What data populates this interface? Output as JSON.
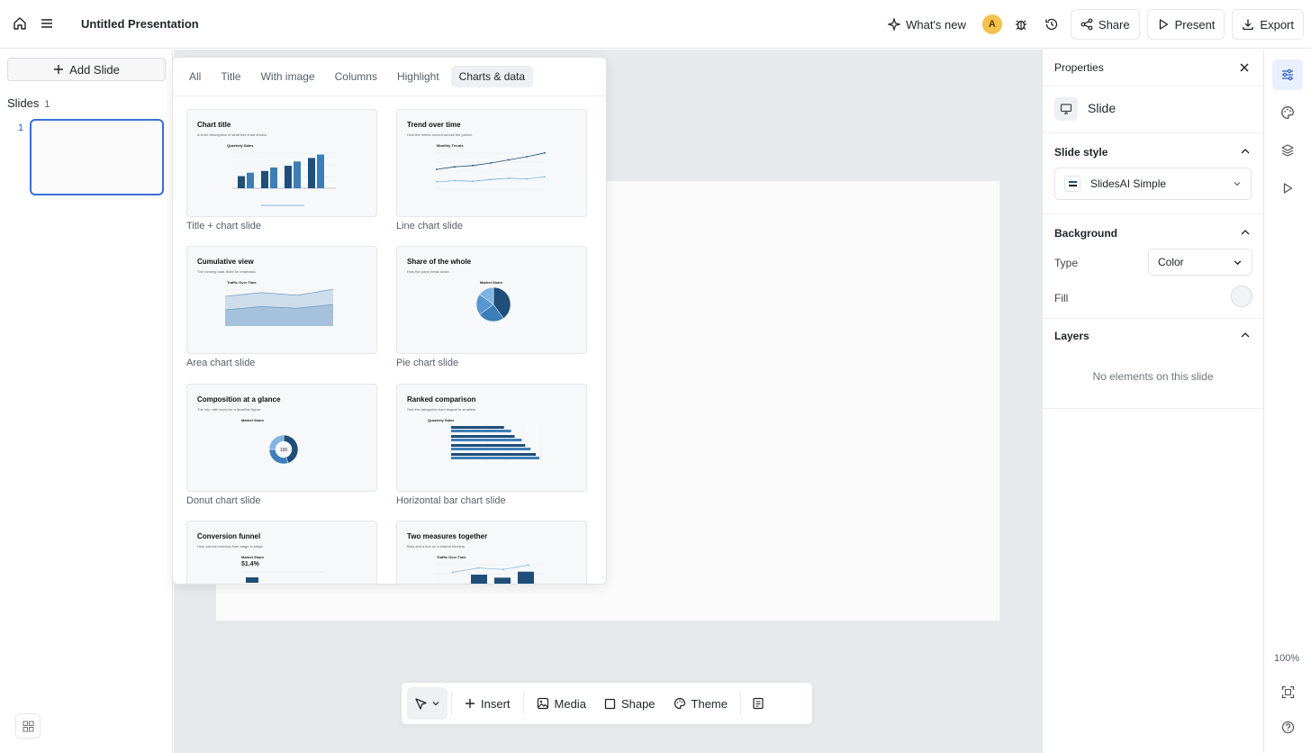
{
  "app": {
    "title": "Untitled Presentation"
  },
  "toolbar": {
    "whats_new": "What's new",
    "avatar_initial": "A",
    "share": "Share",
    "present": "Present",
    "export": "Export"
  },
  "sidebar": {
    "add_slide": "Add Slide",
    "slides_label": "Slides",
    "slides_count": "1",
    "slide_numbers": [
      "1"
    ]
  },
  "template_picker": {
    "tabs": [
      "All",
      "Title",
      "With image",
      "Columns",
      "Highlight",
      "Charts & data"
    ],
    "active_tab": "Charts & data",
    "templates": [
      {
        "preview_title": "Chart title",
        "preview_subtitle": "A short description of what this chart shows.",
        "label": "Title + chart slide"
      },
      {
        "preview_title": "Trend over time",
        "preview_subtitle": "How the metric moved across the period.",
        "label": "Line chart slide"
      },
      {
        "preview_title": "Cumulative view",
        "preview_subtitle": "The running total, filled for emphasis.",
        "label": "Area chart slide"
      },
      {
        "preview_title": "Share of the whole",
        "preview_subtitle": "How the parts break down.",
        "label": "Pie chart slide"
      },
      {
        "preview_title": "Composition at a glance",
        "preview_subtitle": "The mix, with room for a headline figure.",
        "label": "Donut chart slide"
      },
      {
        "preview_title": "Ranked comparison",
        "preview_subtitle": "Sort the categories from largest to smallest.",
        "label": "Horizontal bar chart slide"
      },
      {
        "preview_title": "Conversion funnel",
        "preview_subtitle": "How volume narrows from stage to stage.",
        "label": ""
      },
      {
        "preview_title": "Two measures together",
        "preview_subtitle": "Bars and a line on a shared timeline.",
        "label": ""
      }
    ],
    "mini_charts": {
      "bar": {
        "title": "Quarterly Sales",
        "values": [
          [
            28,
            36
          ],
          [
            40,
            48
          ],
          [
            52,
            62
          ],
          [
            70,
            78
          ]
        ]
      },
      "line": {
        "title": "Monthly Trends",
        "a": [
          40,
          44,
          46,
          50,
          55,
          60,
          66
        ],
        "b": [
          20,
          22,
          21,
          24,
          26,
          25,
          28
        ]
      },
      "area": {
        "title": "Traffic Over Time",
        "a": [
          55,
          62,
          57,
          68
        ],
        "b": [
          30,
          36,
          33,
          40
        ]
      },
      "pie": {
        "title": "Market Share",
        "values": [
          40,
          25,
          20,
          15
        ]
      },
      "donut": {
        "title": "Market Share",
        "center": "100",
        "values": [
          45,
          30,
          25
        ]
      },
      "hbar": {
        "title": "Quarterly Sales",
        "values": [
          [
            60,
            68
          ],
          [
            72,
            80
          ],
          [
            84,
            90
          ],
          [
            96,
            100
          ]
        ]
      },
      "funnel": {
        "title": "Market Share",
        "value": "51.4%"
      },
      "combo": {
        "title": "Traffic Over Time",
        "bars": [
          50,
          35,
          65
        ],
        "line": [
          30,
          45,
          40,
          55
        ]
      }
    }
  },
  "bottom_toolbar": {
    "insert": "Insert",
    "media": "Media",
    "shape": "Shape",
    "theme": "Theme"
  },
  "properties": {
    "title": "Properties",
    "element": "Slide",
    "slide_style": {
      "heading": "Slide style",
      "value": "SlidesAI Simple"
    },
    "background": {
      "heading": "Background",
      "type_label": "Type",
      "type_value": "Color",
      "fill_label": "Fill"
    },
    "layers": {
      "heading": "Layers",
      "empty": "No elements on this slide"
    }
  },
  "zoom": "100%",
  "colors": {
    "accent": "#3b6fd8",
    "chart_dark": "#1f4e79",
    "chart_mid": "#3c7fb8",
    "chart_light": "#7fb4e0",
    "avatar": "#f2c14e"
  }
}
